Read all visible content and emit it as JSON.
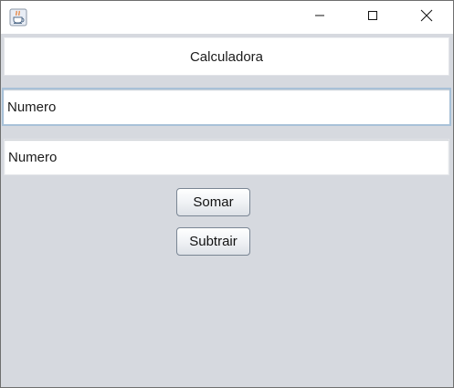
{
  "window": {
    "icon": "java-coffee-cup-icon",
    "controls": [
      "minimize-icon",
      "maximize-icon",
      "close-icon"
    ]
  },
  "header": {
    "title": "Calculadora"
  },
  "inputs": {
    "first_value": "Numero",
    "second_value": "Numero"
  },
  "buttons": {
    "somar_label": "Somar",
    "subtrair_label": "Subtrair"
  },
  "colors": {
    "background": "#d6d9df",
    "focus_border": "#a8c1d8"
  }
}
